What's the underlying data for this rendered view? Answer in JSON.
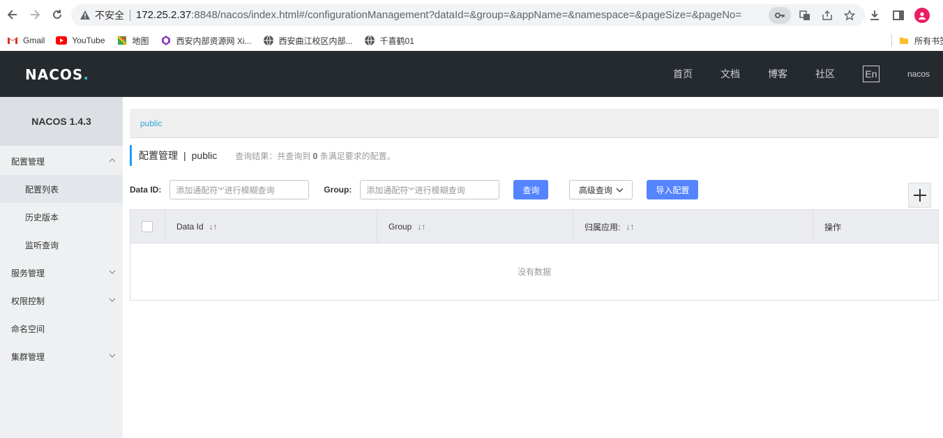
{
  "browser": {
    "insecure_label": "不安全",
    "url_host": "172.25.2.37",
    "url_rest": ":8848/nacos/index.html#/configurationManagement?dataId=&group=&appName=&namespace=&pageSize=&pageNo=",
    "bookmarks": [
      "Gmail",
      "YouTube",
      "地图",
      "西安内部资源网 Xi...",
      "西安曲江校区内部...",
      "千喜鹤01"
    ],
    "all_bookmarks_label": "所有书签"
  },
  "header": {
    "logo": "NACOS",
    "nav": [
      "首页",
      "文档",
      "博客",
      "社区"
    ],
    "lang": "En",
    "user": "nacos"
  },
  "sidebar": {
    "title": "NACOS 1.4.3",
    "items": [
      {
        "label": "配置管理",
        "type": "group",
        "expanded": true
      },
      {
        "label": "配置列表",
        "type": "sub",
        "active": true
      },
      {
        "label": "历史版本",
        "type": "sub"
      },
      {
        "label": "监听查询",
        "type": "sub"
      },
      {
        "label": "服务管理",
        "type": "group"
      },
      {
        "label": "权限控制",
        "type": "group"
      },
      {
        "label": "命名空间",
        "type": "item"
      },
      {
        "label": "集群管理",
        "type": "group"
      }
    ]
  },
  "main": {
    "namespace_link": "public",
    "page_title": "配置管理",
    "page_title_sep": "|",
    "page_namespace": "public",
    "query_result_prefix": "查询结果：共查询到",
    "query_result_count": "0",
    "query_result_suffix": "条满足要求的配置。",
    "search": {
      "data_id_label": "Data ID:",
      "data_id_placeholder": "添加通配符'*'进行模糊查询",
      "group_label": "Group:",
      "group_placeholder": "添加通配符'*'进行模糊查询",
      "query_button": "查询",
      "advanced_button": "高级查询",
      "import_button": "导入配置"
    },
    "table": {
      "columns": [
        "Data Id",
        "Group",
        "归属应用:",
        "操作"
      ],
      "empty_text": "没有数据"
    }
  }
}
